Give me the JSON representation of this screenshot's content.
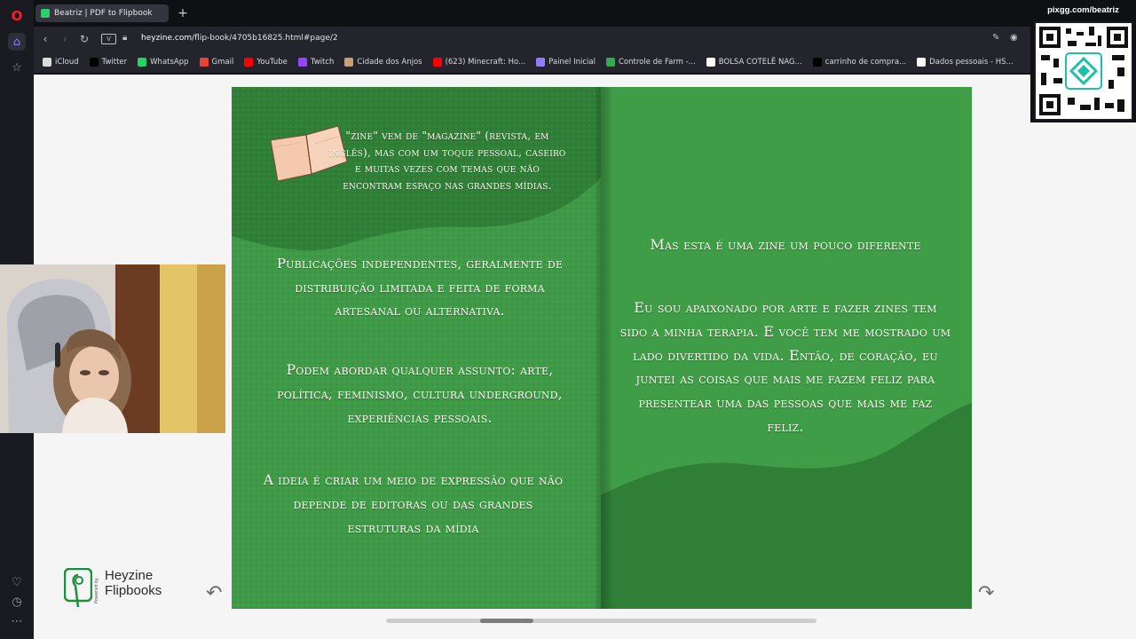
{
  "browser": {
    "tab_title": "Beatriz | PDF to Flipbook",
    "newtab": "+",
    "url_host": "heyzine.com",
    "url_path": "/flip-book/4705b16825.html#page/2",
    "badge": "V"
  },
  "bookmarks": [
    {
      "label": "iCloud",
      "color": "#dcdcdc"
    },
    {
      "label": "Twitter",
      "color": "#000000"
    },
    {
      "label": "WhatsApp",
      "color": "#25d366"
    },
    {
      "label": "Gmail",
      "color": "#ea4335"
    },
    {
      "label": "YouTube",
      "color": "#ff0000"
    },
    {
      "label": "Twitch",
      "color": "#9146ff"
    },
    {
      "label": "Cidade dos Anjos",
      "color": "#c8a07a"
    },
    {
      "label": "(623) Minecraft: Ho...",
      "color": "#ff0000"
    },
    {
      "label": "Painel Inicial",
      "color": "#8e7cff"
    },
    {
      "label": "Controle de Farm -...",
      "color": "#34a853"
    },
    {
      "label": "BOLSA COTELÊ NAG...",
      "color": "#ffffff"
    },
    {
      "label": "carrinho de compra...",
      "color": "#000000"
    },
    {
      "label": "Dados pessoais - HS...",
      "color": "#ffffff"
    }
  ],
  "flipbook": {
    "left_page": {
      "intro": "\"zine\" vem de \"magazine\" (revista, em inglês), mas com um toque pessoal, caseiro e muitas vezes com temas que não encontram espaço nas grandes mídias.",
      "para1": "Publicações independentes, geralmente de distribuição limitada e feita de forma artesanal ou alternativa.",
      "para2": "Podem abordar qualquer assunto: arte, política, feminismo, cultura underground, experiências pessoais.",
      "para3": "A ideia é criar um meio de expressão que não depende de editoras ou das grandes estruturas da mídia"
    },
    "right_page": {
      "heading": "Mas esta é uma zine um pouco diferente",
      "para": "Eu sou apaixonado por arte e fazer zines tem sido a minha terapia. E você tem me mostrado um lado divertido da vida. Então, de coração, eu juntei as coisas que mais me fazem feliz para presentear uma das pessoas que mais me faz feliz."
    },
    "logo": {
      "powered": "Powered by",
      "line1": "Heyzine",
      "line2": "Flipbooks"
    },
    "prev_icon": "↶",
    "next_icon": "↷"
  },
  "overlay": {
    "qr_label": "pixgg.com/beatriz"
  },
  "colors": {
    "page_green": "#3e9a46",
    "page_dark_green": "#2f7f37",
    "accent": "#8e7cff"
  }
}
